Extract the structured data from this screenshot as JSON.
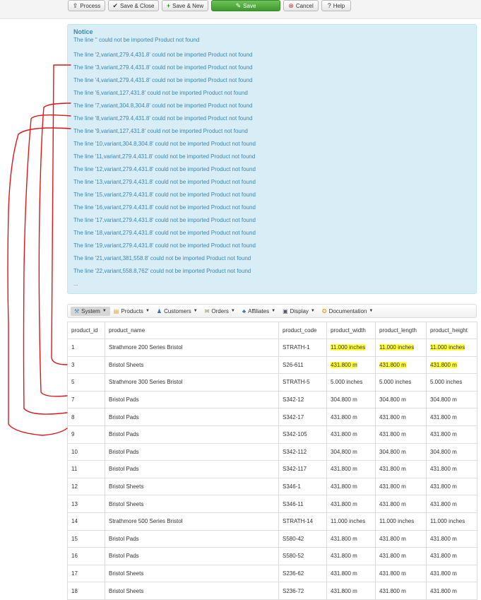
{
  "toolbar": {
    "process": "Process",
    "save_close": "Save & Close",
    "save_new": "Save & New",
    "save": "Save",
    "cancel": "Cancel",
    "help": "Help"
  },
  "notice": {
    "title": "Notice",
    "lines": [
      "The line '' could not be imported Product not found",
      "The line '2,variant,279.4,431.8' could not be imported Product not found",
      "The line '3,variant,279.4,431.8' could not be imported Product not found",
      "The line '4,variant,279.4,431.8' could not be imported Product not found",
      "The line '6,variant,127,431.8' could not be imported Product not found",
      "The line '7,variant,304.8,304.8' could not be imported Product not found",
      "The line '8,variant,279.4,431.8' could not be imported Product not found",
      "The line '9,variant,127,431.8' could not be imported Product not found",
      "The line '10,variant,304.8,304.8' could not be imported Product not found",
      "The line '11,variant,279.4,431.8' could not be imported Product not found",
      "The line '12,variant,279.4,431.8' could not be imported Product not found",
      "The line '13,variant,279.4,431.8' could not be imported Product not found",
      "The line '15,variant,279.4,431.8' could not be imported Product not found",
      "The line '16,variant,279.4,431.8' could not be imported Product not found",
      "The line '17,variant,279.4,431.8' could not be imported Product not found",
      "The line '18,variant,279.4,431.8' could not be imported Product not found",
      "The line '19,variant,279.4,431.8' could not be imported Product not found",
      "The line '21,variant,381,558.8' could not be imported Product not found",
      "The line '22,variant,558.8,762' could not be imported Product not found"
    ],
    "ellipsis": "..."
  },
  "menu": {
    "system": "System",
    "products": "Products",
    "customers": "Customers",
    "orders": "Orders",
    "affiliates": "Affiliates",
    "display": "Display",
    "documentation": "Documentation"
  },
  "table": {
    "headers": [
      "product_id",
      "product_name",
      "product_code",
      "product_width",
      "product_length",
      "product_height"
    ],
    "rows": [
      [
        "1",
        "Strathmore 200 Series Bristol",
        "STRATH-1",
        "11.000 inches",
        "11.000 inches",
        "11.000 inches"
      ],
      [
        "3",
        "Bristol Sheets",
        "S26-611",
        "431.800 m",
        "431.800 m",
        "431.800 m"
      ],
      [
        "5",
        "Strathmore 300 Series Bristol",
        "STRATH-5",
        "5.000 inches",
        "5.000 inches",
        "5.000 inches"
      ],
      [
        "7",
        "Bristol Pads",
        "S342-12",
        "304.800 m",
        "304.800 m",
        "304.800 m"
      ],
      [
        "8",
        "Bristol Pads",
        "S342-17",
        "431.800 m",
        "431.800 m",
        "431.800 m"
      ],
      [
        "9",
        "Bristol Pads",
        "S342-105",
        "431.800 m",
        "431.800 m",
        "431.800 m"
      ],
      [
        "10",
        "Bristol Pads",
        "S342-112",
        "304.800 m",
        "304.800 m",
        "304.800 m"
      ],
      [
        "11",
        "Bristol Pads",
        "S342-117",
        "431.800 m",
        "431.800 m",
        "431.800 m"
      ],
      [
        "12",
        "Bristol Sheets",
        "S346-1",
        "431.800 m",
        "431.800 m",
        "431.800 m"
      ],
      [
        "13",
        "Bristol Sheets",
        "S346-11",
        "431.800 m",
        "431.800 m",
        "431.800 m"
      ],
      [
        "14",
        "Strathmore 500 Series Bristol",
        "STRATH-14",
        "11.000 inches",
        "11.000 inches",
        "11.000 inches"
      ],
      [
        "15",
        "Bristol Pads",
        "S580-42",
        "431.800 m",
        "431.800 m",
        "431.800 m"
      ],
      [
        "16",
        "Bristol Pads",
        "S580-52",
        "431.800 m",
        "431.800 m",
        "431.800 m"
      ],
      [
        "17",
        "Bristol Sheets",
        "S236-62",
        "431.800 m",
        "431.800 m",
        "431.800 m"
      ],
      [
        "18",
        "Bristol Sheets",
        "S236-72",
        "431.800 m",
        "431.800 m",
        "431.800 m"
      ]
    ]
  },
  "colors": {
    "notice_bg": "#d9edf7",
    "notice_text": "#3a87ad",
    "save_green": "#4caf3a",
    "highlight": "#ffff3a",
    "annotation_red": "#e0151c"
  }
}
